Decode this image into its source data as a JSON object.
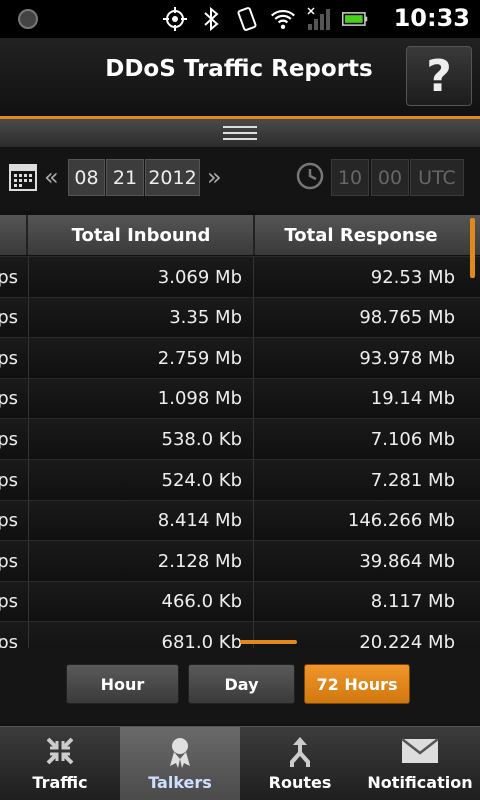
{
  "status_bar": {
    "time": "10:33"
  },
  "header": {
    "title": "DDoS Traffic Reports",
    "help_label": "?"
  },
  "date_selector": {
    "prev_arrow": "«",
    "month": "08",
    "day": "21",
    "year": "2012",
    "next_arrow": "»",
    "hour": "10",
    "minute": "00",
    "timezone": "UTC"
  },
  "table": {
    "columns": [
      "Total Inbound",
      "Total Response"
    ],
    "rows": [
      {
        "partial": "ps",
        "inbound": "3.069 Mb",
        "response": "92.53 Mb"
      },
      {
        "partial": "ps",
        "inbound": "3.35 Mb",
        "response": "98.765 Mb"
      },
      {
        "partial": "ps",
        "inbound": "2.759 Mb",
        "response": "93.978 Mb"
      },
      {
        "partial": "ps",
        "inbound": "1.098 Mb",
        "response": "19.14 Mb"
      },
      {
        "partial": "ps",
        "inbound": "538.0 Kb",
        "response": "7.106 Mb"
      },
      {
        "partial": "ps",
        "inbound": "524.0 Kb",
        "response": "7.281 Mb"
      },
      {
        "partial": "ps",
        "inbound": "8.414 Mb",
        "response": "146.266 Mb"
      },
      {
        "partial": "ps",
        "inbound": "2.128 Mb",
        "response": "39.864 Mb"
      },
      {
        "partial": "ps",
        "inbound": "466.0 Kb",
        "response": "8.117 Mb"
      },
      {
        "partial": "ps",
        "inbound": "681.0 Kb",
        "response": "20.224 Mb"
      }
    ]
  },
  "range_buttons": {
    "hour": "Hour",
    "day": "Day",
    "hours72": "72 Hours",
    "selected": "72 Hours"
  },
  "tabs": [
    {
      "label": "Traffic",
      "icon": "traffic-icon"
    },
    {
      "label": "Talkers",
      "icon": "talkers-icon",
      "active": true
    },
    {
      "label": "Routes",
      "icon": "routes-icon"
    },
    {
      "label": "Notification",
      "icon": "mail-icon"
    }
  ],
  "colors": {
    "accent": "#e08a1e",
    "background": "#111111"
  }
}
